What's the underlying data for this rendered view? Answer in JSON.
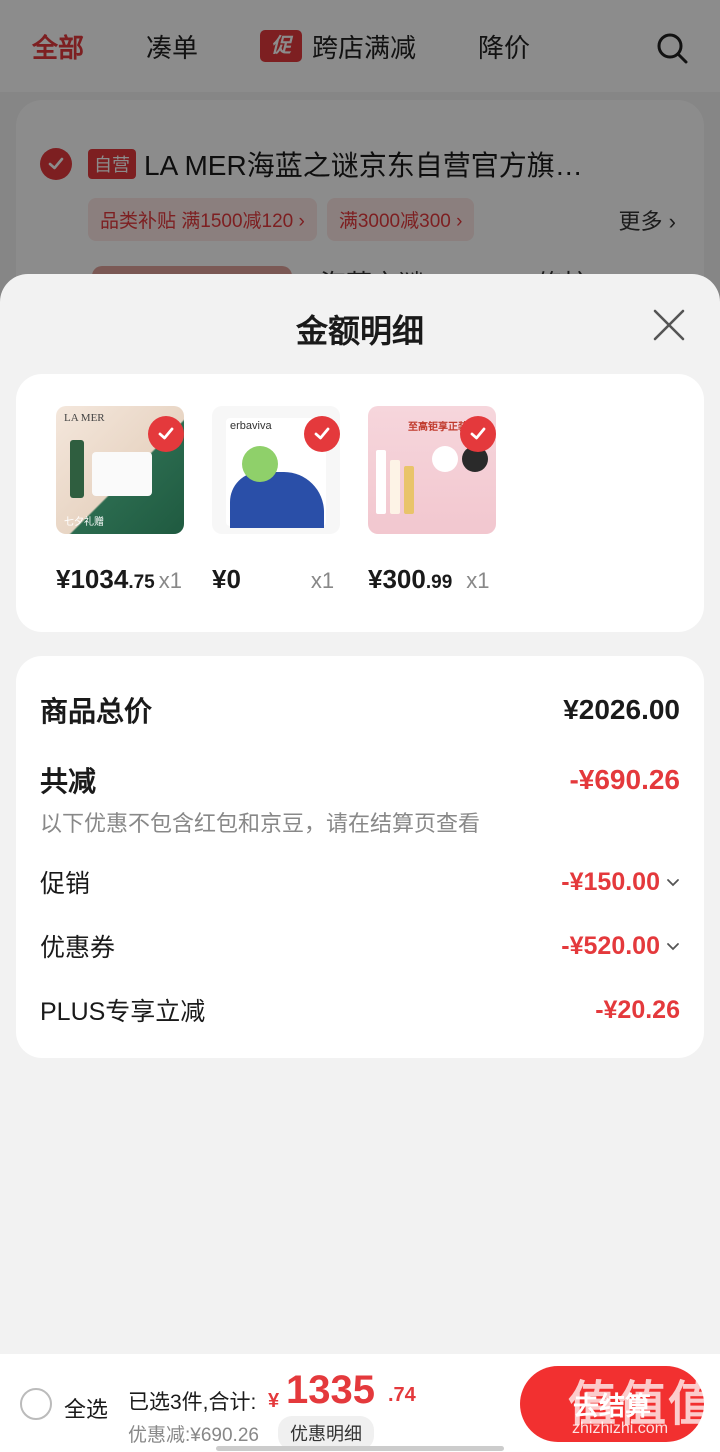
{
  "background": {
    "tabs": [
      {
        "label": "全部"
      },
      {
        "label": "凑单"
      },
      {
        "label": "跨店满减",
        "badge": "促"
      },
      {
        "label": "降价"
      }
    ],
    "shop": {
      "self_badge": "自营",
      "name": "LA MER海蓝之谜京东自营官方旗…",
      "promos": [
        "品类补贴 满1500减120 ›",
        "满3000减300 ›"
      ],
      "more": "更多 ›",
      "peek_text": "海蓝之谜(LA MER)修护"
    }
  },
  "sheet": {
    "title": "金额明细",
    "products": [
      {
        "price_main": "¥1034",
        "price_dec": ".75",
        "qty": "x1",
        "image_text": "LA MER",
        "image_sub": "七夕礼赠"
      },
      {
        "price_main": "¥0",
        "price_dec": "",
        "qty": "x1",
        "image_text": "erbaviva"
      },
      {
        "price_main": "¥300",
        "price_dec": ".99",
        "qty": "x1",
        "image_text": "至高钜享正装礼"
      }
    ],
    "details": {
      "total_label": "商品总价",
      "total_value": "¥2026.00",
      "discount_label": "共减",
      "discount_value": "-¥690.26",
      "note": "以下优惠不包含红包和京豆，请在结算页查看",
      "promo_label": "促销",
      "promo_value": "-¥150.00",
      "coupon_label": "优惠券",
      "coupon_value": "-¥520.00",
      "plus_label": "PLUS专享立减",
      "plus_value": "-¥20.26"
    }
  },
  "bottom": {
    "select_all": "全选",
    "selected": "已选3件,合计:",
    "total_yen": "¥",
    "total_main": "1335",
    "total_dec": ".74",
    "saved": "优惠减:¥690.26",
    "detail_button": "优惠明细",
    "checkout": "去结算",
    "watermark": "值值值",
    "watermark_url": "zhizhizhi.com"
  },
  "colors": {
    "accent": "#e4393c",
    "checkout": "#f23030"
  }
}
